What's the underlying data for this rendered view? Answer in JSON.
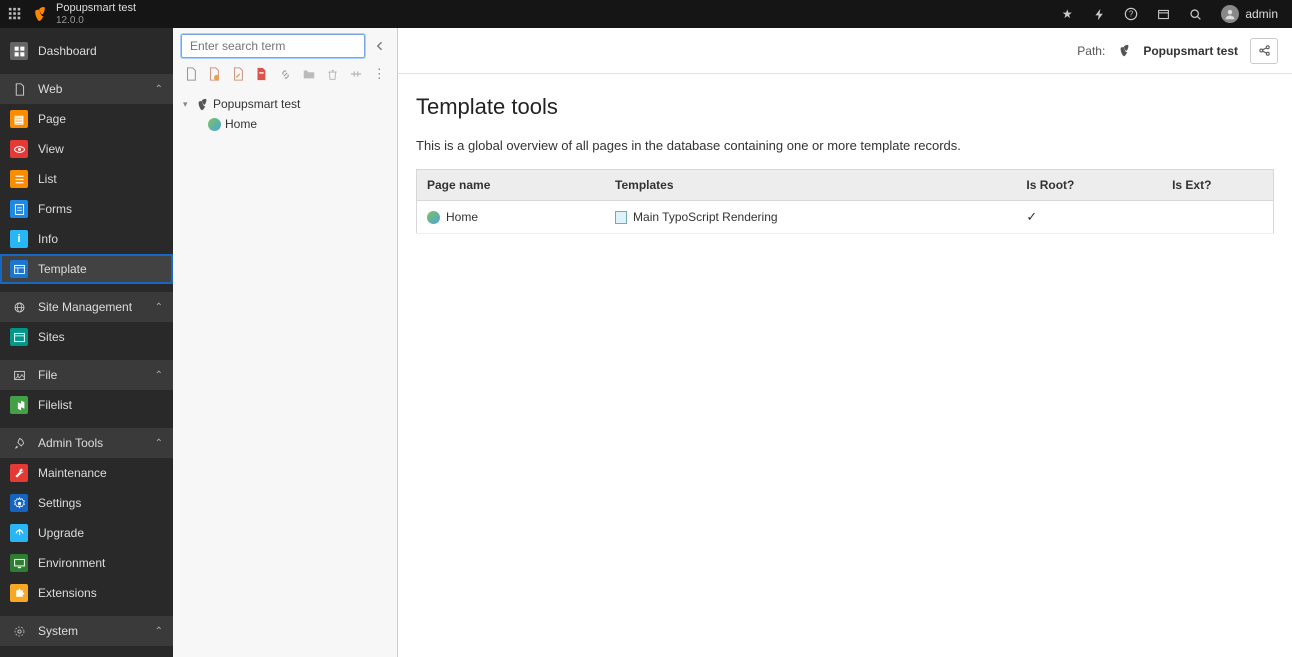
{
  "topbar": {
    "site_title": "Popupsmart test",
    "version": "12.0.0",
    "user": "admin"
  },
  "sidebar": {
    "dashboard": "Dashboard",
    "group_web": "Web",
    "page": "Page",
    "view": "View",
    "list": "List",
    "forms": "Forms",
    "info": "Info",
    "template": "Template",
    "group_site": "Site Management",
    "sites": "Sites",
    "group_file": "File",
    "filelist": "Filelist",
    "group_admin": "Admin Tools",
    "maintenance": "Maintenance",
    "settings": "Settings",
    "upgrade": "Upgrade",
    "environment": "Environment",
    "extensions": "Extensions",
    "group_system": "System"
  },
  "pagetree": {
    "search_placeholder": "Enter search term",
    "root": "Popupsmart test",
    "home": "Home"
  },
  "header": {
    "path_label": "Path:",
    "path_name": "Popupsmart test"
  },
  "main": {
    "title": "Template tools",
    "description": "This is a global overview of all pages in the database containing one or more template records.",
    "columns": {
      "page_name": "Page name",
      "templates": "Templates",
      "is_root": "Is Root?",
      "is_ext": "Is Ext?"
    },
    "rows": [
      {
        "page_name": "Home",
        "template": "Main TypoScript Rendering",
        "is_root": true,
        "is_ext": false
      }
    ]
  }
}
